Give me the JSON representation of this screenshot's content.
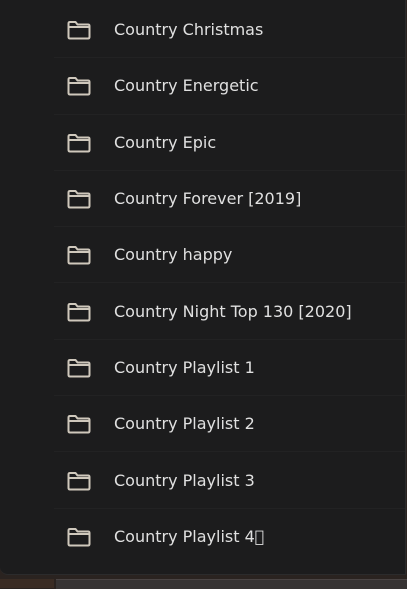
{
  "folders": [
    {
      "label": "Country Christmas",
      "icon": "folder-icon"
    },
    {
      "label": "Country Energetic",
      "icon": "folder-icon"
    },
    {
      "label": "Country Epic",
      "icon": "folder-icon"
    },
    {
      "label": "Country Forever [2019]",
      "icon": "folder-icon"
    },
    {
      "label": "Country happy",
      "icon": "folder-icon"
    },
    {
      "label": "Country Night Top 130 [2020]",
      "icon": "folder-icon"
    },
    {
      "label": "Country Playlist 1",
      "icon": "folder-icon"
    },
    {
      "label": "Country Playlist 2",
      "icon": "folder-icon"
    },
    {
      "label": "Country Playlist 3",
      "icon": "folder-icon"
    },
    {
      "label": "Country Playlist 4⃣",
      "icon": "folder-icon"
    }
  ],
  "colors": {
    "panel_bg": "#1c1c1d",
    "text": "#e0e0e0",
    "icon_stroke": "#cfc8bc",
    "outer_bg": "#2a2320"
  }
}
